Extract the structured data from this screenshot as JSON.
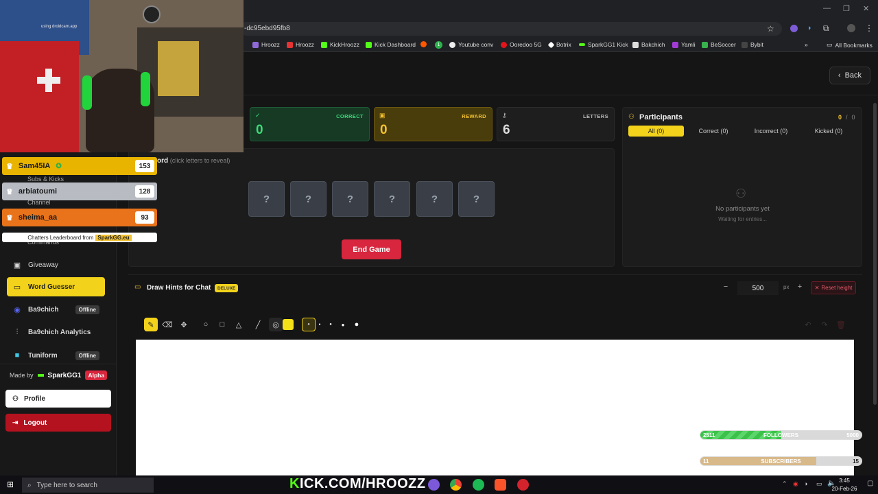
{
  "browser": {
    "url_fragment": "-dc95ebd95fb8",
    "bookmarks": [
      "Hroozz",
      "Hroozz",
      "KickHroozz",
      "Kick Dashboard",
      "Youtube conv",
      "Ooredoo 5G",
      "Botrix",
      "SparkGG1 Kick",
      "Bakchich",
      "Yamli",
      "BeSoccer",
      "Bybit"
    ],
    "bookmark_badge": "1",
    "all_bookmarks": "All Bookmarks"
  },
  "header": {
    "back_label": "Back"
  },
  "stats": {
    "correct": {
      "label": "CORRECT",
      "value": "0"
    },
    "reward": {
      "label": "REWARD",
      "value": "0"
    },
    "letters": {
      "label": "LETTERS",
      "value": "6"
    }
  },
  "word": {
    "title_fragment": "ord",
    "hint": "(click letters to reveal)",
    "letters": [
      "?",
      "?",
      "?",
      "?",
      "?",
      "?"
    ],
    "end_game_label": "End Game"
  },
  "participants": {
    "title": "Participants",
    "count_current": "0",
    "count_sep": "/",
    "count_total": "0",
    "tabs": [
      "All (0)",
      "Correct (0)",
      "Incorrect (0)",
      "Kicked (0)"
    ],
    "empty_title": "No participants yet",
    "empty_sub": "Waiting for entries..."
  },
  "draw": {
    "title": "Draw Hints for Chat",
    "badge": "DELUXE",
    "height_value": "500",
    "height_unit": "px",
    "reset_label": "Reset height",
    "active_color": "#f5e118"
  },
  "sidebar": {
    "partial_items": [
      "Subs & Kicks",
      "Channel",
      "Commands"
    ],
    "items": [
      {
        "label": "Giveaway",
        "icon": "gift-icon"
      },
      {
        "label": "Word Guesser",
        "icon": "gamepad-icon",
        "active": true
      },
      {
        "label": "Ba9chich",
        "icon": "discord-icon",
        "badge": "Offline"
      },
      {
        "label": "Ba9chich Analytics",
        "icon": "chart-icon"
      },
      {
        "label": "Tuniform",
        "icon": "app-icon",
        "badge": "Offline"
      }
    ],
    "made_by": "Made by",
    "author": "SparkGG1",
    "alpha": "Alpha",
    "profile_label": "Profile",
    "logout_label": "Logout"
  },
  "overlay": {
    "watermark": "using droidcam.app",
    "leaderboard": [
      {
        "name": "Sam45IA",
        "score": "153",
        "color": "#e8b400"
      },
      {
        "name": "arbiatoumi",
        "score": "128",
        "color": "#b8bcc2"
      },
      {
        "name": "sheima_aa",
        "score": "93",
        "color": "#e8731a"
      }
    ],
    "leaderboard_caption": "Chatters Leaderboard from",
    "leaderboard_brand": "SparkGG.eu",
    "followers": {
      "label": "FOLLOWERS",
      "current": "2511",
      "goal": "5000",
      "progress": 0.5
    },
    "subscribers": {
      "label": "SUBSCRIBERS",
      "current": "11",
      "goal": "15",
      "progress": 0.72
    }
  },
  "taskbar": {
    "search_placeholder": "Type here to search",
    "stream_url": "KICK.COM/HROOZZ",
    "time": "3:45",
    "date": "20-Feb-26"
  }
}
